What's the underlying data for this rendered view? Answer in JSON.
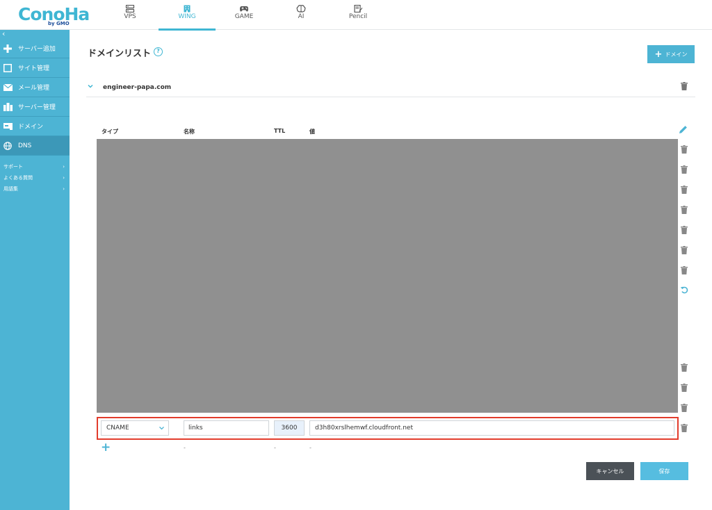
{
  "brand": {
    "name": "ConoHa",
    "sub": "by GMO"
  },
  "topnav": [
    {
      "label": "VPS",
      "icon": "server-icon"
    },
    {
      "label": "WING",
      "icon": "building-icon",
      "active": true
    },
    {
      "label": "GAME",
      "icon": "gamepad-icon"
    },
    {
      "label": "AI",
      "icon": "brain-icon"
    },
    {
      "label": "Pencil",
      "icon": "pencil-note-icon"
    }
  ],
  "sidebar": {
    "collapse_glyph": "‹",
    "items": [
      {
        "label": "サーバー追加",
        "icon": "plus-icon"
      },
      {
        "label": "サイト管理",
        "icon": "window-icon"
      },
      {
        "label": "メール管理",
        "icon": "mail-icon"
      },
      {
        "label": "サーバー管理",
        "icon": "server-manage-icon"
      },
      {
        "label": "ドメイン",
        "icon": "domain-icon"
      },
      {
        "label": "DNS",
        "icon": "globe-icon",
        "active": true
      }
    ],
    "links": [
      {
        "label": "サポート",
        "arrow": "›"
      },
      {
        "label": "よくある質問",
        "arrow": "›"
      },
      {
        "label": "用語集",
        "arrow": "›"
      }
    ]
  },
  "main": {
    "title": "ドメインリスト",
    "help_glyph": "?",
    "add_domain_label": "ドメイン",
    "add_domain_plus": "+",
    "domain": "engineer-papa.com",
    "columns": {
      "type": "タイプ",
      "name": "名称",
      "ttl": "TTL",
      "value": "値"
    },
    "new_record": {
      "type": "CNAME",
      "name": "links",
      "ttl": "3600",
      "value": "d3h80xrslhemwf.cloudfront.net"
    },
    "add_record_glyph": "+",
    "dash": "-",
    "cancel_label": "キャンセル",
    "save_label": "保存"
  },
  "colors": {
    "accent": "#4db4d4",
    "highlight": "#e23c2c",
    "cancel": "#4b5157"
  }
}
